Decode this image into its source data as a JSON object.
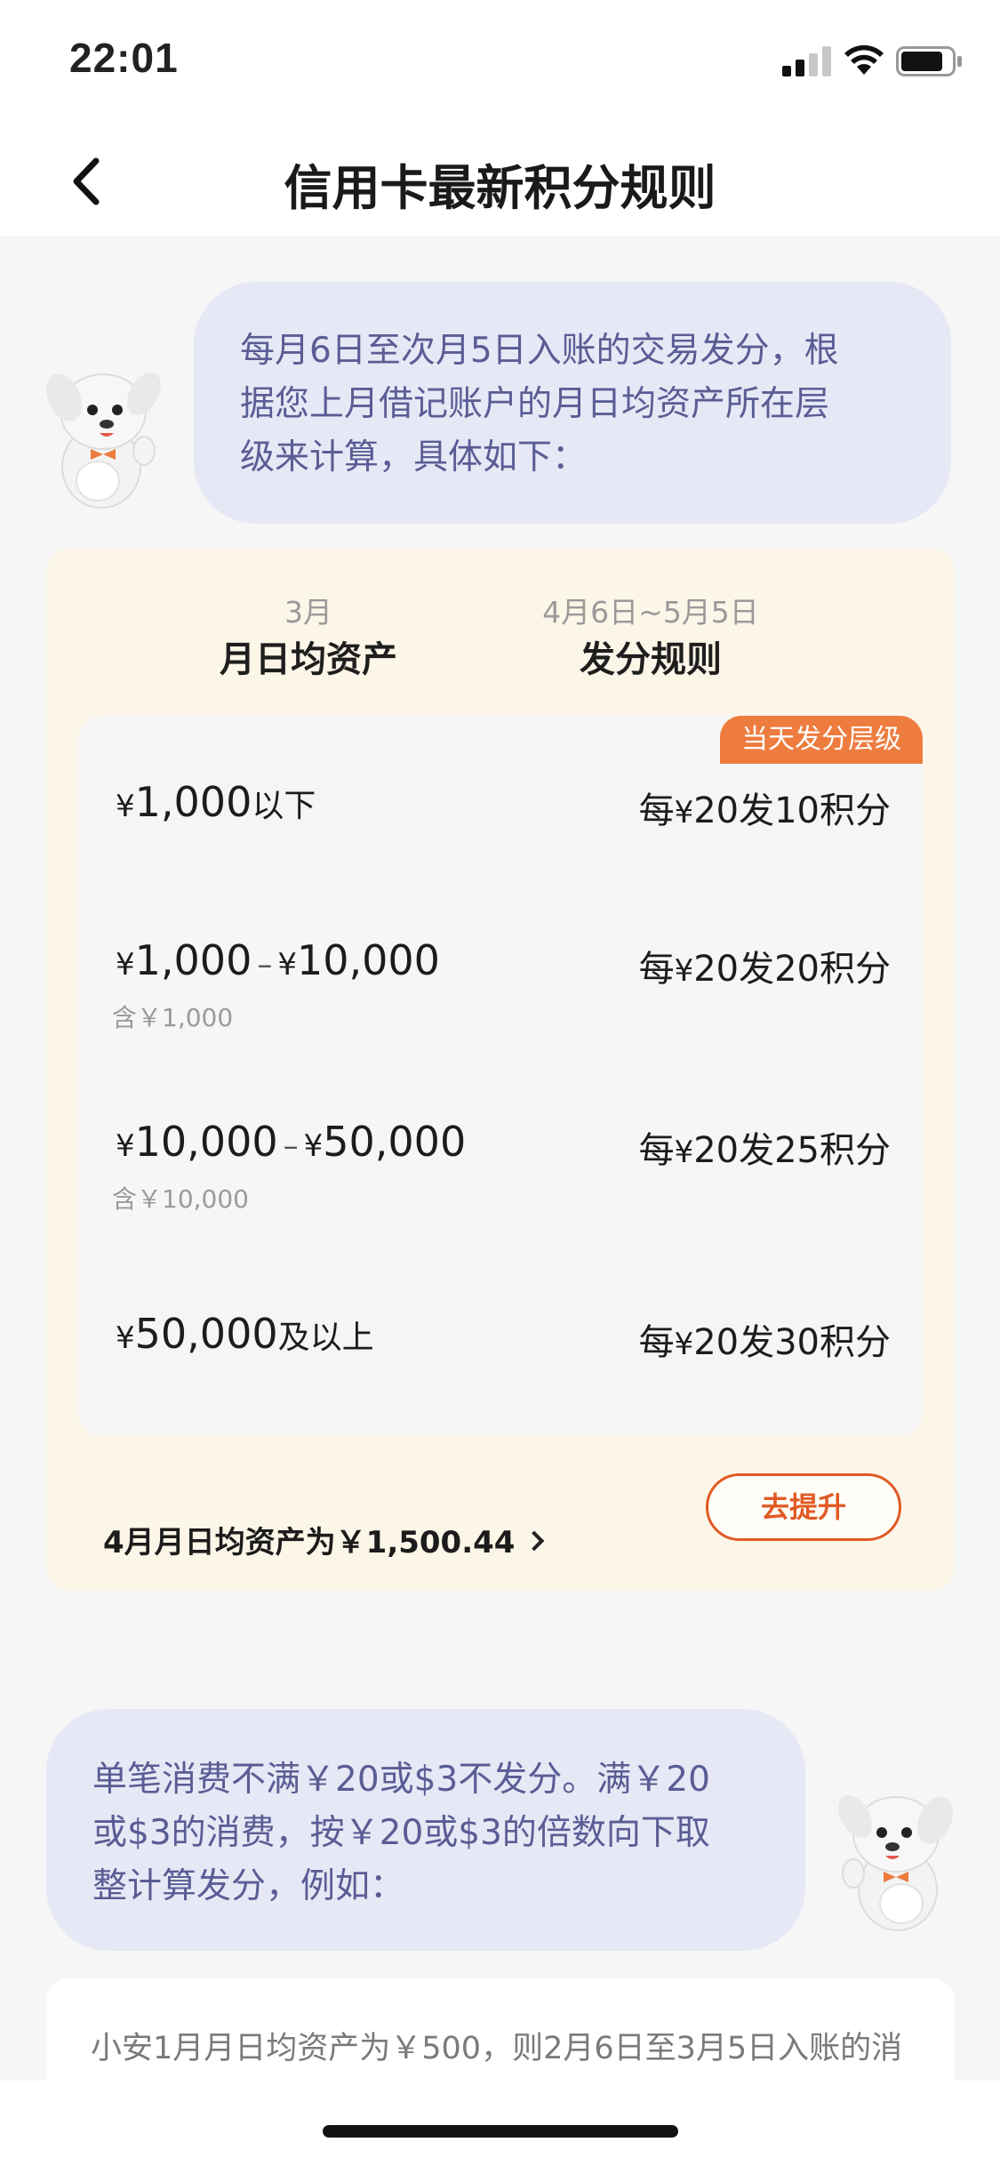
{
  "status": {
    "time": "22:01"
  },
  "nav": {
    "title": "信用卡最新积分规则"
  },
  "intro_bubble": {
    "lines": [
      "每月6日至次月5日入账的交易发分，根",
      "据您上月借记账户的月日均资产所在层",
      "级来计算，具体如下："
    ]
  },
  "rules": {
    "col1_sub": "3月",
    "col1_title": "月日均资产",
    "col2_sub": "4月6日~5月5日",
    "col2_title": "发分规则",
    "current_tag": "当天发分层级",
    "tiers": [
      {
        "yen": "¥",
        "amount": "1,000",
        "suffix": "以下",
        "rule_prefix": "每",
        "rule_yen": "¥",
        "rule_value": "20发10积分"
      },
      {
        "yen": "¥",
        "amount": "1,000",
        "dash": "–",
        "yen2": "¥",
        "amount2": "10,000",
        "note": "含￥1,000",
        "rule_prefix": "每",
        "rule_yen": "¥",
        "rule_value": "20发20积分"
      },
      {
        "yen": "¥",
        "amount": "10,000",
        "dash": "–",
        "yen2": "¥",
        "amount2": "50,000",
        "note": "含￥10,000",
        "rule_prefix": "每",
        "rule_yen": "¥",
        "rule_value": "20发25积分"
      },
      {
        "yen": "¥",
        "amount": "50,000",
        "suffix": "及以上",
        "rule_prefix": "每",
        "rule_yen": "¥",
        "rule_value": "20发30积分"
      }
    ],
    "asset_link": "4月月日均资产为￥1,500.44",
    "upgrade_label": "去提升"
  },
  "second_bubble": {
    "lines": [
      "单笔消费不满￥20或$3不发分。满￥20",
      "或$3的消费，按￥20或$3的倍数向下取",
      "整计算发分，例如："
    ]
  },
  "example": {
    "text": "小安1月月日均资产为￥500，则2月6日至3月5日入账的消"
  },
  "icons": [
    "signal-icon",
    "wifi-icon",
    "battery-icon",
    "back-chevron-icon",
    "mascot-dog-icon",
    "chevron-right-icon"
  ],
  "colors": {
    "accent": "#e25a24",
    "tag": "#ee7c3f",
    "bubble": "#e6e8f6",
    "bubble_text": "#5a5d94",
    "card": "#fbf6e7"
  }
}
